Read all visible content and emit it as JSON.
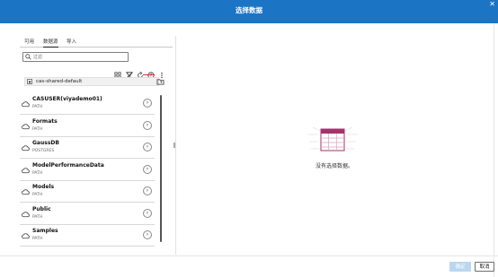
{
  "dialog": {
    "title": "选择数据"
  },
  "tabs": [
    {
      "label": "可用",
      "active": false
    },
    {
      "label": "数据源",
      "active": true
    },
    {
      "label": "导入",
      "active": false
    }
  ],
  "filter": {
    "placeholder": "过滤",
    "value": ""
  },
  "toolbar": {
    "icons": [
      "grid-view-icon",
      "filter-off-icon",
      "refresh-icon",
      "help-icon",
      "more-options-icon"
    ],
    "active_icon": "filter-off-icon",
    "active_color": "#d62e2e"
  },
  "server": {
    "name": "cas-shared-default"
  },
  "libraries": [
    {
      "name": "CASUSER(viyademo01)",
      "type": "PATH"
    },
    {
      "name": "Formats",
      "type": "PATH"
    },
    {
      "name": "GaussDB",
      "type": "POSTGRES"
    },
    {
      "name": "ModelPerformanceData",
      "type": "PATH"
    },
    {
      "name": "Models",
      "type": "PATH"
    },
    {
      "name": "Public",
      "type": "PATH"
    },
    {
      "name": "Samples",
      "type": "PATH"
    }
  ],
  "empty_state": {
    "message": "没有选择数据。"
  },
  "buttons": {
    "ok": "确定",
    "cancel": "取消"
  },
  "colors": {
    "header": "#1c74c4",
    "ok_disabled": "#b9d7f1",
    "empty_icon": "#a6326b"
  }
}
